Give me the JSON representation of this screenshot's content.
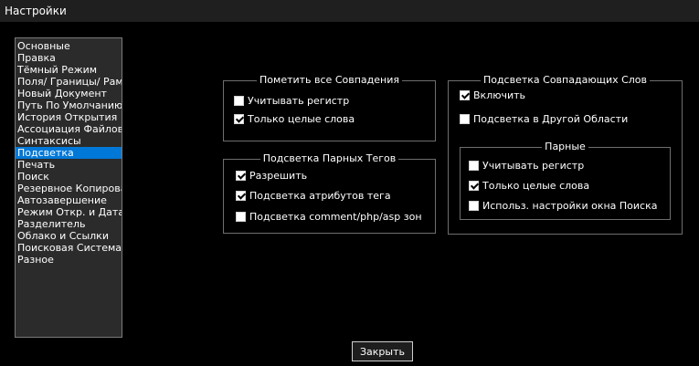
{
  "window": {
    "title": "Настройки"
  },
  "categories": [
    {
      "label": "Основные",
      "selected": false
    },
    {
      "label": "Правка",
      "selected": false
    },
    {
      "label": "Тёмный Режим",
      "selected": false
    },
    {
      "label": "Поля/ Границы/ Рамки",
      "selected": false
    },
    {
      "label": "Новый Документ",
      "selected": false
    },
    {
      "label": "Путь По Умолчанию",
      "selected": false
    },
    {
      "label": "История Открытия",
      "selected": false
    },
    {
      "label": "Ассоциация Файлов",
      "selected": false
    },
    {
      "label": "Синтаксисы",
      "selected": false
    },
    {
      "label": "Подсветка",
      "selected": true
    },
    {
      "label": "Печать",
      "selected": false
    },
    {
      "label": "Поиск",
      "selected": false
    },
    {
      "label": "Резервное Копирование",
      "selected": false
    },
    {
      "label": "Автозавершение",
      "selected": false
    },
    {
      "label": "Режим Откр. и Дата",
      "selected": false
    },
    {
      "label": "Разделитель",
      "selected": false
    },
    {
      "label": "Облако и Ссылки",
      "selected": false
    },
    {
      "label": "Поисковая Система",
      "selected": false
    },
    {
      "label": "Разное",
      "selected": false
    }
  ],
  "mark_all": {
    "title": "Пометить все Совпадения",
    "match_case": {
      "label": "Учитывать регистр",
      "checked": false
    },
    "whole_word": {
      "label": "Только целые слова",
      "checked": true
    }
  },
  "tag_match": {
    "title": "Подсветка Парных Тегов",
    "enable": {
      "label": "Разрешить",
      "checked": true
    },
    "attributes": {
      "label": "Подсветка атрибутов тега",
      "checked": true
    },
    "php_zones": {
      "label": "Подсветка comment/php/asp зон",
      "checked": false
    }
  },
  "smart_highlight": {
    "title": "Подсветка Совпадающих Слов",
    "enable": {
      "label": "Включить",
      "checked": true
    },
    "other_view": {
      "label": "Подсветка в Другой Области",
      "checked": false
    },
    "matching": {
      "title": "Парные",
      "match_case": {
        "label": "Учитывать регистр",
        "checked": false
      },
      "whole_word": {
        "label": "Только целые слова",
        "checked": true
      },
      "use_find_settings": {
        "label": "Использ. настройки окна Поиска",
        "checked": false
      }
    }
  },
  "footer": {
    "close_label": "Закрыть"
  }
}
